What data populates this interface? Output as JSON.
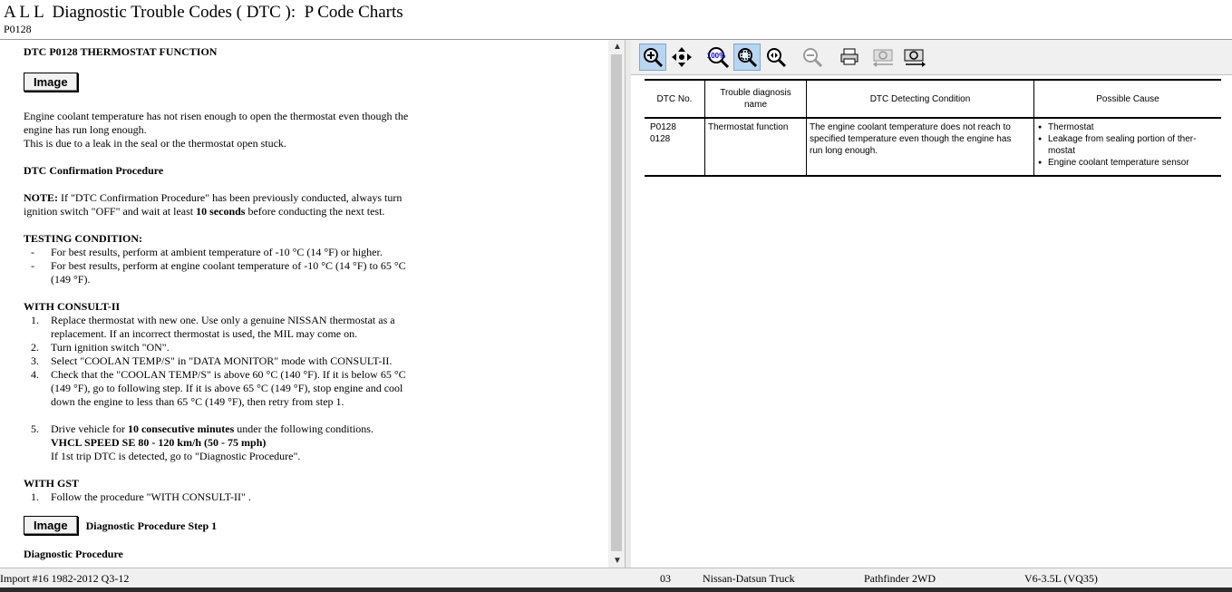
{
  "header": {
    "title": "A L L  Diagnostic Trouble Codes ( DTC ):  P Code Charts",
    "code": "P0128"
  },
  "doc": {
    "heading": "DTC P0128 THERMOSTAT FUNCTION",
    "image_button": "Image",
    "intro1": "Engine coolant temperature has not risen enough to open the thermostat even though the",
    "intro2": "engine has run long enough.",
    "intro3": "This is due to a leak in the seal or the thermostat open stuck.",
    "confirm_heading": "DTC Confirmation Procedure",
    "note_label": "NOTE:",
    "note_a": " If \"DTC Confirmation Procedure\" has been previously conducted, always turn",
    "note_b": "ignition switch \"OFF\" and wait at least ",
    "note_bold": "10 seconds",
    "note_c": " before conducting the next test.",
    "testing_heading": "TESTING CONDITION:",
    "testing_items": [
      {
        "mark": "-",
        "lines": [
          "For best results, perform at ambient temperature of -10 °C (14 °F) or higher."
        ]
      },
      {
        "mark": "-",
        "lines": [
          "For best results, perform at engine coolant temperature of -10 °C (14 °F) to 65 °C",
          "(149 °F)."
        ]
      }
    ],
    "consult_heading": "WITH CONSULT-II",
    "consult_items": [
      {
        "mark": "1.",
        "lines": [
          "Replace thermostat with new one. Use only a genuine NISSAN thermostat as a",
          "replacement. If an incorrect thermostat is used, the MIL may come on."
        ]
      },
      {
        "mark": "2.",
        "lines": [
          "Turn ignition switch \"ON\"."
        ]
      },
      {
        "mark": "3.",
        "lines": [
          "Select \"COOLAN TEMP/S\" in \"DATA MONITOR\" mode with CONSULT-II."
        ]
      },
      {
        "mark": "4.",
        "lines": [
          "Check that the \"COOLAN TEMP/S\" is above 60 °C (140 °F). If it is below 65 °C",
          "(149 °F), go to following step. If it is above 65 °C (149 °F), stop engine and cool",
          "down the engine to less than 65 °C (149 °F), then retry from step 1."
        ]
      }
    ],
    "step5_mark": "5.",
    "step5_a": "Drive vehicle for ",
    "step5_bold": "10 consecutive minutes",
    "step5_b": " under the following conditions.",
    "step5_line2": "VHCL SPEED SE  80 - 120 km/h (50 - 75 mph)",
    "step5_line3": "If 1st trip DTC is detected, go to \"Diagnostic Procedure\".",
    "gst_heading": "WITH GST",
    "gst_items": [
      {
        "mark": "1.",
        "lines": [
          "Follow the procedure \"WITH CONSULT-II\" ."
        ]
      }
    ],
    "image_button2": "Image",
    "diag_step": "Diagnostic Procedure Step 1",
    "diag_partial": "Diagnostic Procedure"
  },
  "toolbar": {
    "icons": [
      "zoom-in-icon",
      "pan-icon",
      "zoom-100-icon",
      "zoom-fit-icon",
      "zoom-window-icon",
      "zoom-out-icon",
      "print-icon",
      "copy-image-icon",
      "save-image-icon"
    ],
    "zoom100_label": "100%"
  },
  "table": {
    "headers": [
      "DTC No.",
      "Trouble diagnosis name",
      "DTC Detecting Condition",
      "Possible Cause"
    ],
    "row": {
      "dtc": [
        "P0128",
        "0128"
      ],
      "name": "Thermostat function",
      "condition": [
        "The engine coolant temperature does not reach to",
        "specified temperature even though the engine has",
        "run long enough."
      ],
      "causes": [
        "Thermostat",
        "Leakage from sealing portion of ther-",
        "mostat",
        "Engine coolant temperature sensor"
      ]
    }
  },
  "status": {
    "import": "Import #16 1982-2012 Q3-12",
    "num": "03",
    "make": "Nissan-Datsun Truck",
    "model": "Pathfinder 2WD",
    "engine": "V6-3.5L (VQ35)"
  },
  "colors": {
    "toolbar_bg": "#f0f0f0",
    "active_button": "#b8d6f2",
    "status_bg": "#f0f0f0"
  }
}
